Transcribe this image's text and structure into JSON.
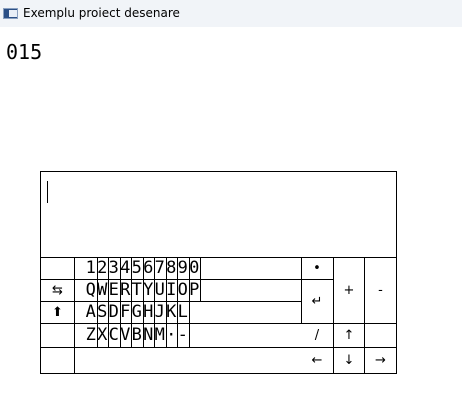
{
  "window": {
    "title": "Exemplu proiect desenare",
    "icon": "app-window-icon"
  },
  "counter": "015",
  "display": {
    "text": ""
  },
  "keyboard": {
    "rows": [
      {
        "keys": [
          "1",
          "2",
          "3",
          "4",
          "5",
          "6",
          "7",
          "8",
          "9",
          "0"
        ]
      },
      {
        "keys": [
          "Q",
          "W",
          "E",
          "R",
          "T",
          "Y",
          "U",
          "I",
          "O",
          "P"
        ]
      },
      {
        "keys": [
          "A",
          "S",
          "D",
          "F",
          "G",
          "H",
          "J",
          "K",
          "L"
        ]
      },
      {
        "keys": [
          "Z",
          "X",
          "C",
          "V",
          "B",
          "N",
          "M",
          "·",
          "-"
        ]
      }
    ],
    "left": {
      "tab": "⇆",
      "shift": "⬆"
    },
    "right": {
      "bullet": "•",
      "enter": "↵",
      "plus": "+",
      "minus": "-",
      "slash": "/",
      "up": "↑",
      "left": "←",
      "down": "↓",
      "right": "→"
    }
  }
}
